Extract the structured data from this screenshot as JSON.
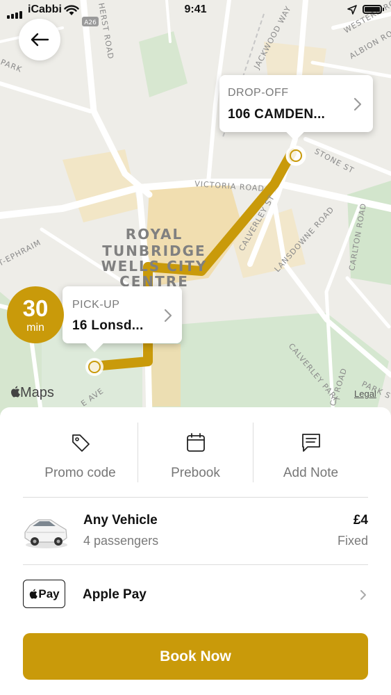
{
  "status_bar": {
    "carrier": "iCabbi",
    "time": "9:41"
  },
  "map": {
    "district_label": [
      "ROYAL",
      "TUNBRIDGE",
      "WELLS CITY",
      "CENTRE"
    ],
    "street_labels": [
      "HERST ROAD",
      "JACKWOOD WAY",
      "WESTERN ROAD",
      "ALBION ROAD",
      "VICTORIA ROAD",
      "STONE ST",
      "LANSDOWNE ROAD",
      "CALVERLEY ST",
      "CARLTON ROAD",
      "CALVERLEY PARK",
      "PARK ST",
      "CT ROAD",
      "T-EPHRAIM",
      "PARK",
      "E AVE",
      "A26"
    ],
    "maps_logo": "Maps",
    "legal": "Legal",
    "route_color": "#c99a0a"
  },
  "dropoff": {
    "label": "DROP-OFF",
    "address": "106 CAMDEN..."
  },
  "pickup": {
    "label": "PICK-UP",
    "address": "16 Lonsd..."
  },
  "eta": {
    "value": "30",
    "unit": "min"
  },
  "options": [
    {
      "label": "Promo code",
      "icon": "tag-icon"
    },
    {
      "label": "Prebook",
      "icon": "calendar-icon"
    },
    {
      "label": "Add Note",
      "icon": "note-icon"
    }
  ],
  "vehicle": {
    "name": "Any Vehicle",
    "passengers": "4 passengers",
    "price": "£4",
    "price_type": "Fixed"
  },
  "payment": {
    "badge": "Pay",
    "name": "Apple Pay"
  },
  "book_button": "Book Now",
  "colors": {
    "accent": "#c99a0a",
    "muted_text": "#777777"
  }
}
